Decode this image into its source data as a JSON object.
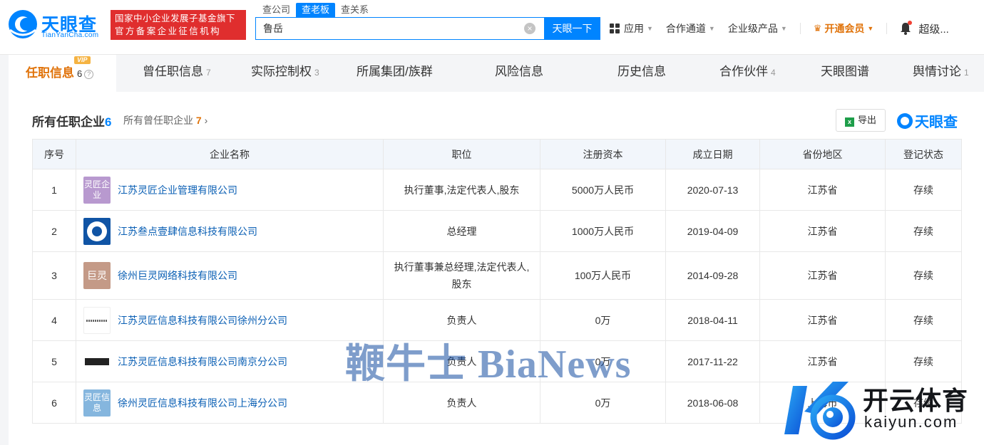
{
  "header": {
    "logo_text": "天眼查",
    "logo_domain": "TianYanCha.com",
    "gov_badge_line1": "国家中小企业发展子基金旗下",
    "gov_badge_line2": "官方备案企业征信机构",
    "search_tabs": [
      "查公司",
      "查老板",
      "查关系"
    ],
    "search_value": "鲁岳",
    "search_button": "天眼一下",
    "nav": {
      "apps": "应用",
      "channels": "合作通道",
      "enterprise": "企业级产品",
      "vip": "开通会员",
      "user": "超级..."
    }
  },
  "tabs": {
    "vip_tag": "VIP",
    "items": [
      {
        "label": "任职信息",
        "count": "6"
      },
      {
        "label": "曾任职信息",
        "count": "7"
      },
      {
        "label": "实际控制权",
        "count": "3"
      },
      {
        "label": "所属集团/族群",
        "count": ""
      },
      {
        "label": "风险信息",
        "count": ""
      },
      {
        "label": "历史信息",
        "count": ""
      },
      {
        "label": "合作伙伴",
        "count": "4"
      },
      {
        "label": "天眼图谱",
        "count": ""
      },
      {
        "label": "舆情讨论",
        "count": "1"
      }
    ]
  },
  "section": {
    "title": "所有任职企业",
    "count": "6",
    "sub_link": "所有曾任职企业",
    "sub_count": "7",
    "export": "导出",
    "brand": "天眼查"
  },
  "table": {
    "headers": [
      "序号",
      "企业名称",
      "职位",
      "注册资本",
      "成立日期",
      "省份地区",
      "登记状态"
    ],
    "rows": [
      {
        "no": "1",
        "logo": "灵匠企业",
        "name": "江苏灵匠企业管理有限公司",
        "position": "执行董事,法定代表人,股东",
        "capital": "5000万人民币",
        "date": "2020-07-13",
        "region": "江苏省",
        "status": "存续"
      },
      {
        "no": "2",
        "logo": "",
        "name": "江苏叁点壹肆信息科技有限公司",
        "position": "总经理",
        "capital": "1000万人民币",
        "date": "2019-04-09",
        "region": "江苏省",
        "status": "存续"
      },
      {
        "no": "3",
        "logo": "巨灵",
        "name": "徐州巨灵网络科技有限公司",
        "position": "执行董事兼总经理,法定代表人,股东",
        "capital": "100万人民币",
        "date": "2014-09-28",
        "region": "江苏省",
        "status": "存续"
      },
      {
        "no": "4",
        "logo": "",
        "name": "江苏灵匠信息科技有限公司徐州分公司",
        "position": "负责人",
        "capital": "0万",
        "date": "2018-04-11",
        "region": "江苏省",
        "status": "存续"
      },
      {
        "no": "5",
        "logo": "",
        "name": "江苏灵匠信息科技有限公司南京分公司",
        "position": "负责人",
        "capital": "0万",
        "date": "2017-11-22",
        "region": "江苏省",
        "status": "存续"
      },
      {
        "no": "6",
        "logo": "灵匠信息",
        "name": "徐州灵匠信息科技有限公司上海分公司",
        "position": "负责人",
        "capital": "0万",
        "date": "2018-06-08",
        "region": "上海市",
        "status": "存续"
      }
    ]
  },
  "watermarks": {
    "bianews": "鞭牛士 BiaNews",
    "kaiyun_title": "开云体育",
    "kaiyun_url": "kaiyun.com"
  },
  "colors": {
    "brand_blue": "#0084ff",
    "vip_orange": "#e0730a",
    "status_green": "#1e9e4a",
    "link_blue": "#0a5fb4",
    "badge_red": "#e02e2e"
  }
}
